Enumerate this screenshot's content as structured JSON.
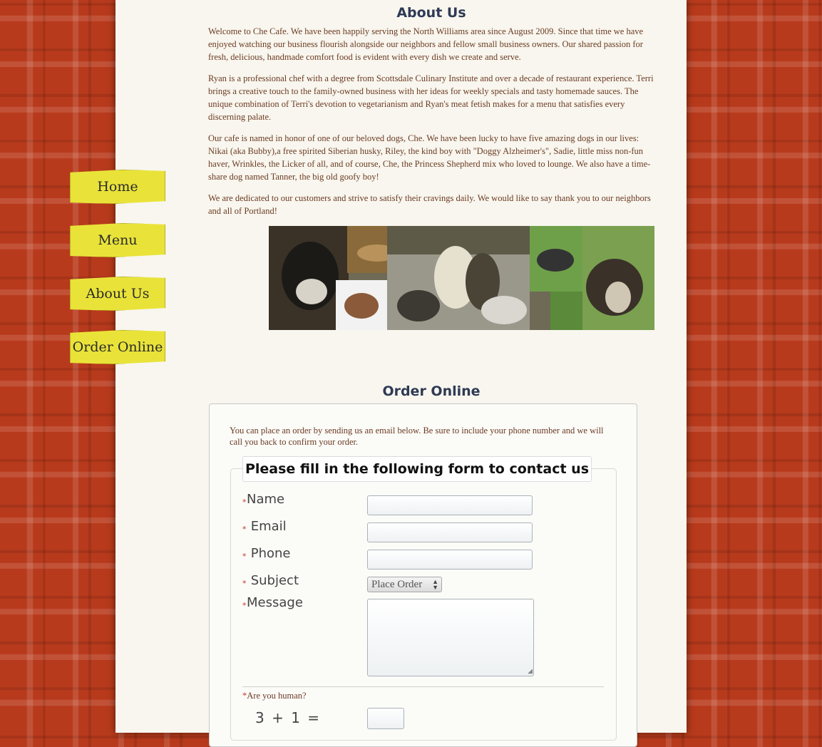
{
  "nav": {
    "items": [
      {
        "label": "Home"
      },
      {
        "label": "Menu"
      },
      {
        "label": "About Us"
      },
      {
        "label": "Order Online"
      }
    ]
  },
  "about": {
    "title": "About Us",
    "paragraphs": [
      "Welcome to Che Cafe. We have been happily serving the North Williams area since August 2009. Since that time we have enjoyed watching our business flourish alongside our neighbors and fellow small business owners. Our shared passion for fresh, delicious, handmade comfort food is evident with every dish we create and serve.",
      "Ryan is a professional chef with a degree from Scottsdale Culinary Institute and over a decade of restaurant experience. Terri brings a creative touch to the family-owned business with her ideas for weekly specials and tasty homemade sauces. The unique combination of Terri's devotion to vegetarianism and Ryan's meat fetish makes for a menu that satisfies every discerning palate.",
      "Our cafe is named in honor of one of our beloved dogs, Che. We have been lucky to have five amazing dogs in our lives: Nikai (aka Bubby),a free spirited Siberian husky, Riley, the kind boy with \"Doggy Alzheimer's\", Sadie, little miss non-fun haver, Wrinkles, the Licker of all, and of course, Che, the Princess Shepherd mix who loved to lounge. We also have a time-share dog named Tanner, the big old goofy boy!",
      "We are dedicated to our customers and strive to satisfy their cravings daily. We would like to say thank you to our neighbors and all of Portland!"
    ]
  },
  "order": {
    "title": "Order Online",
    "intro": "You can place an order by sending us an email below. Be sure to include your phone number and we will call you back to confirm your order.",
    "legend": "Please fill in the following form to contact us",
    "required_mark": "*",
    "fields": {
      "name": "Name",
      "email": " Email",
      "phone": " Phone",
      "subject": " Subject",
      "message": "Message"
    },
    "subject_value": "Place Order",
    "captcha_label": "Are you human?",
    "captcha_question": "3 + 1 ="
  },
  "colors": {
    "background": "#b83a1c",
    "page": "#f8f6ee",
    "nav_button": "#e9e339",
    "title": "#2e3a55",
    "body_text": "#6b3a22"
  }
}
